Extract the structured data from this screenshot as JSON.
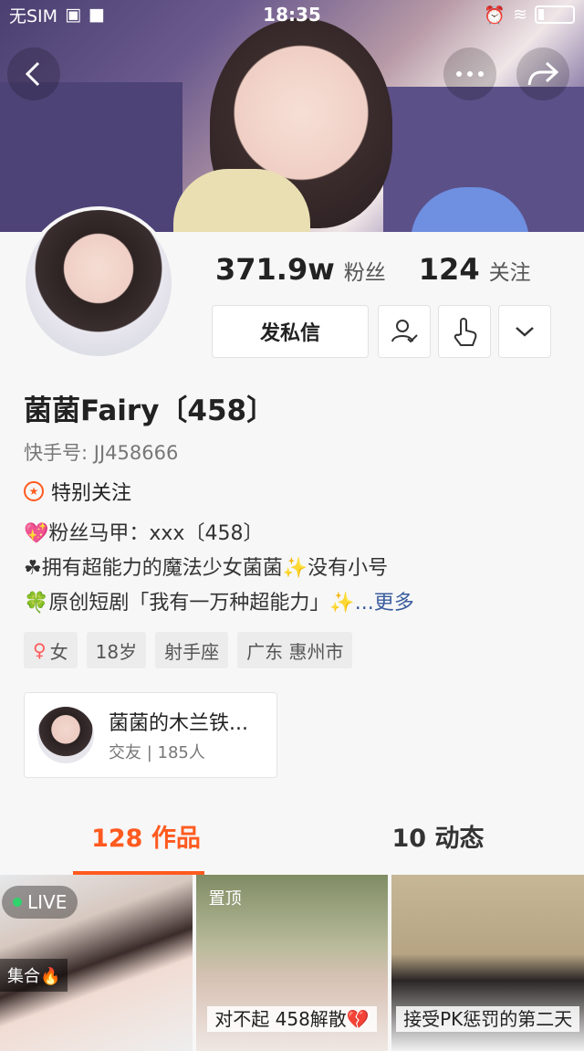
{
  "status": {
    "carrier": "无SIM",
    "time": "18:35"
  },
  "profile": {
    "followers_count": "371.9w",
    "followers_label": "粉丝",
    "following_count": "124",
    "following_label": "关注",
    "message_button": "发私信",
    "name": "菌菌Fairy〔458〕",
    "kuaishou_id": "快手号: JJ458666",
    "special_follow": "特别关注",
    "bio_line1": "💖粉丝马甲：xxx〔458〕",
    "bio_line2": "☘拥有超能力的魔法少女菌菌✨没有小号",
    "bio_line3": "🍀原创短剧「我有一万种超能力」✨",
    "bio_more": "...更多",
    "tags": [
      "女",
      "18岁",
      "射手座",
      "广东 惠州市"
    ]
  },
  "group": {
    "name": "菌菌的木兰铁...",
    "sub": "交友 | 185人"
  },
  "tabs": [
    {
      "label": "128 作品"
    },
    {
      "label": "10 动态"
    }
  ],
  "videos": [
    {
      "badge": "LIVE",
      "collection": "集合🔥"
    },
    {
      "pinned": "置顶",
      "caption": "对不起 458解散💔"
    },
    {
      "caption": "接受PK惩罚的第二天"
    }
  ],
  "colors": {
    "accent": "#ff5a1f",
    "link": "#3a5c9e"
  }
}
